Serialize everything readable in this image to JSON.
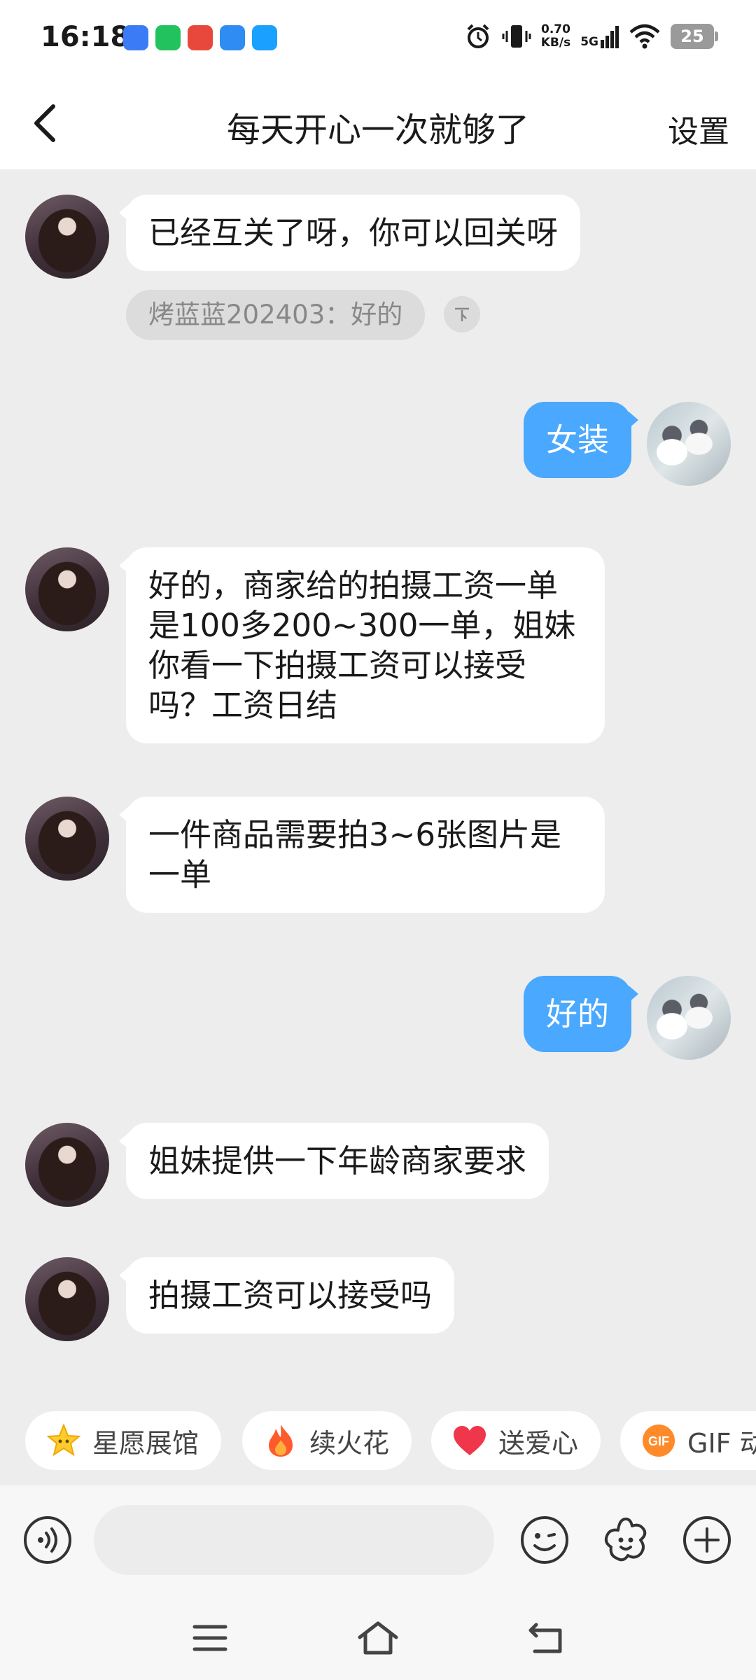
{
  "status_bar": {
    "time": "16:18",
    "network_speed_value": "0.70",
    "network_speed_unit": "KB/s",
    "signal": "5G",
    "battery": "25",
    "app_icon_colors": [
      "#3b7cf6",
      "#22c35e",
      "#e8483b",
      "#2f8cf3",
      "#1aa1ff"
    ]
  },
  "header": {
    "title": "每天开心一次就够了",
    "settings_label": "设置",
    "back_icon": "chevron-left-icon"
  },
  "chat": {
    "messages": [
      {
        "side": "left",
        "text": "已经互关了呀，你可以回关呀"
      },
      {
        "side": "right",
        "text": "女装"
      },
      {
        "side": "left",
        "text": "好的，商家给的拍摄工资一单是100多200~300一单，姐妹你看一下拍摄工资可以接受吗？工资日结"
      },
      {
        "side": "left",
        "text": "一件商品需要拍3~6张图片是一单"
      },
      {
        "side": "right",
        "text": "好的"
      },
      {
        "side": "left",
        "text": "姐妹提供一下年龄商家要求"
      },
      {
        "side": "left",
        "text": "拍摄工资可以接受吗"
      }
    ],
    "quote": {
      "text": "烤蓝蓝202403：好的",
      "icon": "collapse-icon"
    }
  },
  "quick_actions": [
    {
      "label": "星愿展馆",
      "icon": "star-icon"
    },
    {
      "label": "续火花",
      "icon": "fire-icon"
    },
    {
      "label": "送爱心",
      "icon": "heart-icon"
    },
    {
      "label": "GIF 动",
      "icon": "gif-icon"
    }
  ],
  "input_bar": {
    "placeholder": "",
    "icons": [
      "voice-icon",
      "emoji-icon",
      "sticker-icon",
      "plus-icon"
    ]
  },
  "colors": {
    "accent_blue": "#4aa8ff",
    "background": "#ededed"
  }
}
